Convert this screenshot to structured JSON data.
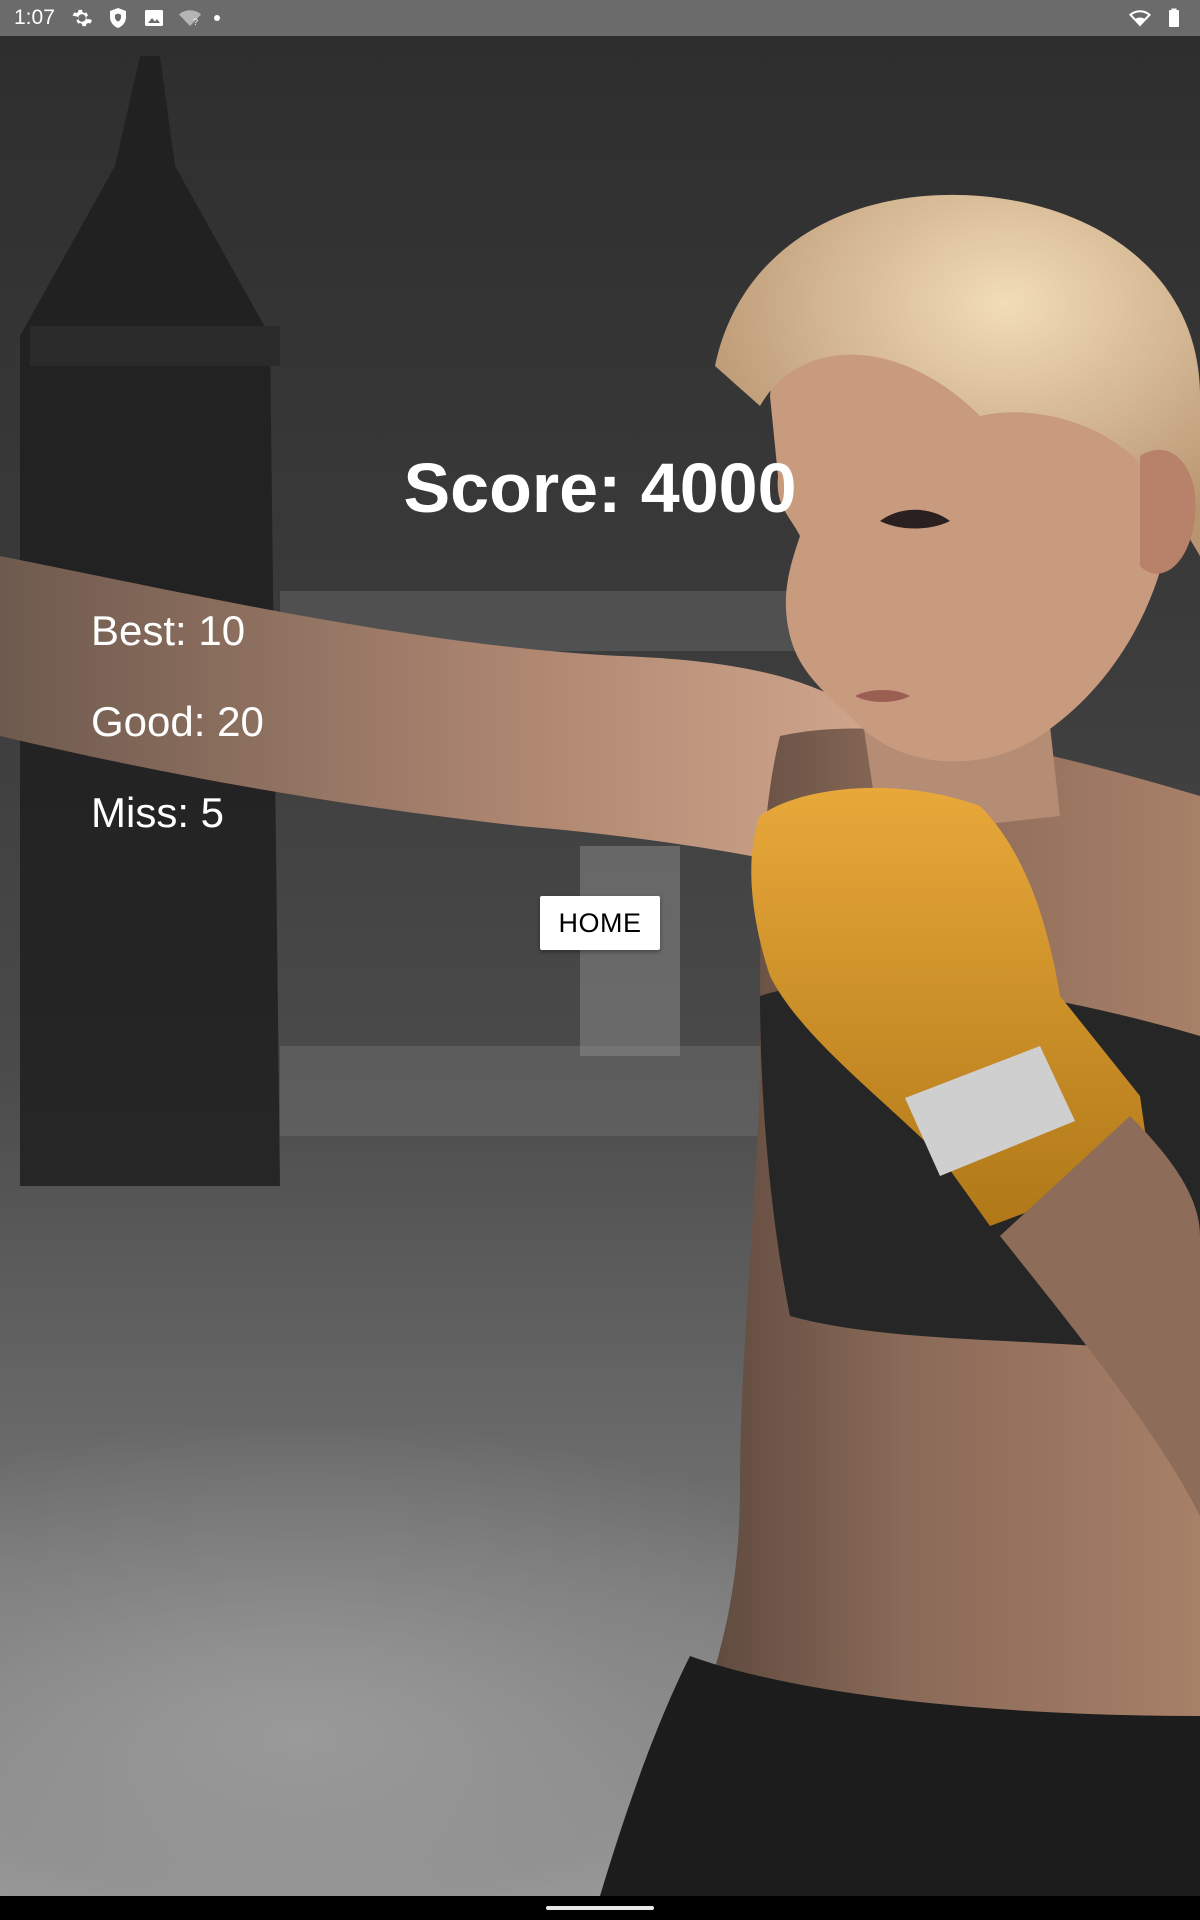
{
  "status_bar": {
    "time": "1:07",
    "left_icons": [
      "settings-icon",
      "shield-icon",
      "image-icon",
      "wifi-question-icon",
      "notification-dot"
    ],
    "right_icons": [
      "wifi-icon",
      "battery-icon"
    ]
  },
  "result": {
    "score_label": "Score: 4000",
    "best_label": "Best: 10",
    "good_label": "Good: 20",
    "miss_label": "Miss: 5"
  },
  "actions": {
    "home_label": "HOME"
  },
  "colors": {
    "text": "#ffffff",
    "button_bg": "#ffffff",
    "button_text": "#000000",
    "wrap_accent": "#d89a28"
  }
}
